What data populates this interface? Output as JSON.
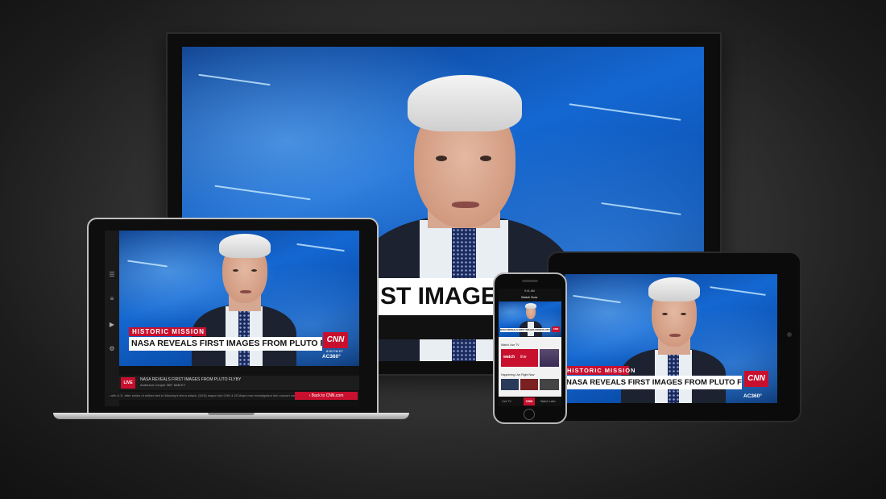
{
  "broadcast": {
    "tag": "HISTORIC MISSION",
    "headline": "NASA REVEALS FIRST IMAGES FROM PLUTO FLYBY",
    "tv_headline_fragment": "ST IMAGES FRO",
    "network": "CNN",
    "show": "AC360°",
    "time": "8:55 PM ET"
  },
  "laptop": {
    "live_label": "LIVE",
    "now_playing_title": "NASA REVEALS FIRST IMAGES FROM PLUTO FLYBY",
    "now_playing_subtitle": "Anderson Cooper 360° 8AM ET",
    "back_link": "‹ Back to CNN.com",
    "ticker": "...with U.S. after series of strikes tied to Monday's terror attack. (5/15) mayor told CNN    4:20    Major new investigation into concert comm"
  },
  "phone": {
    "status_time": "9:41 AM",
    "header": "Watch Now",
    "section_1": "Watch Live TV",
    "promo_badge": "watch",
    "promo_text": "live",
    "section_2": "Happening Live Right Now",
    "tabs": [
      "Live TV",
      "CNN",
      "Watch Later"
    ]
  },
  "icons": {
    "laptop_side": [
      "channels-icon",
      "schedule-icon",
      "videos-icon",
      "settings-icon"
    ]
  },
  "colors": {
    "cnn_red": "#c8102e",
    "background": "#2a2a2a"
  }
}
